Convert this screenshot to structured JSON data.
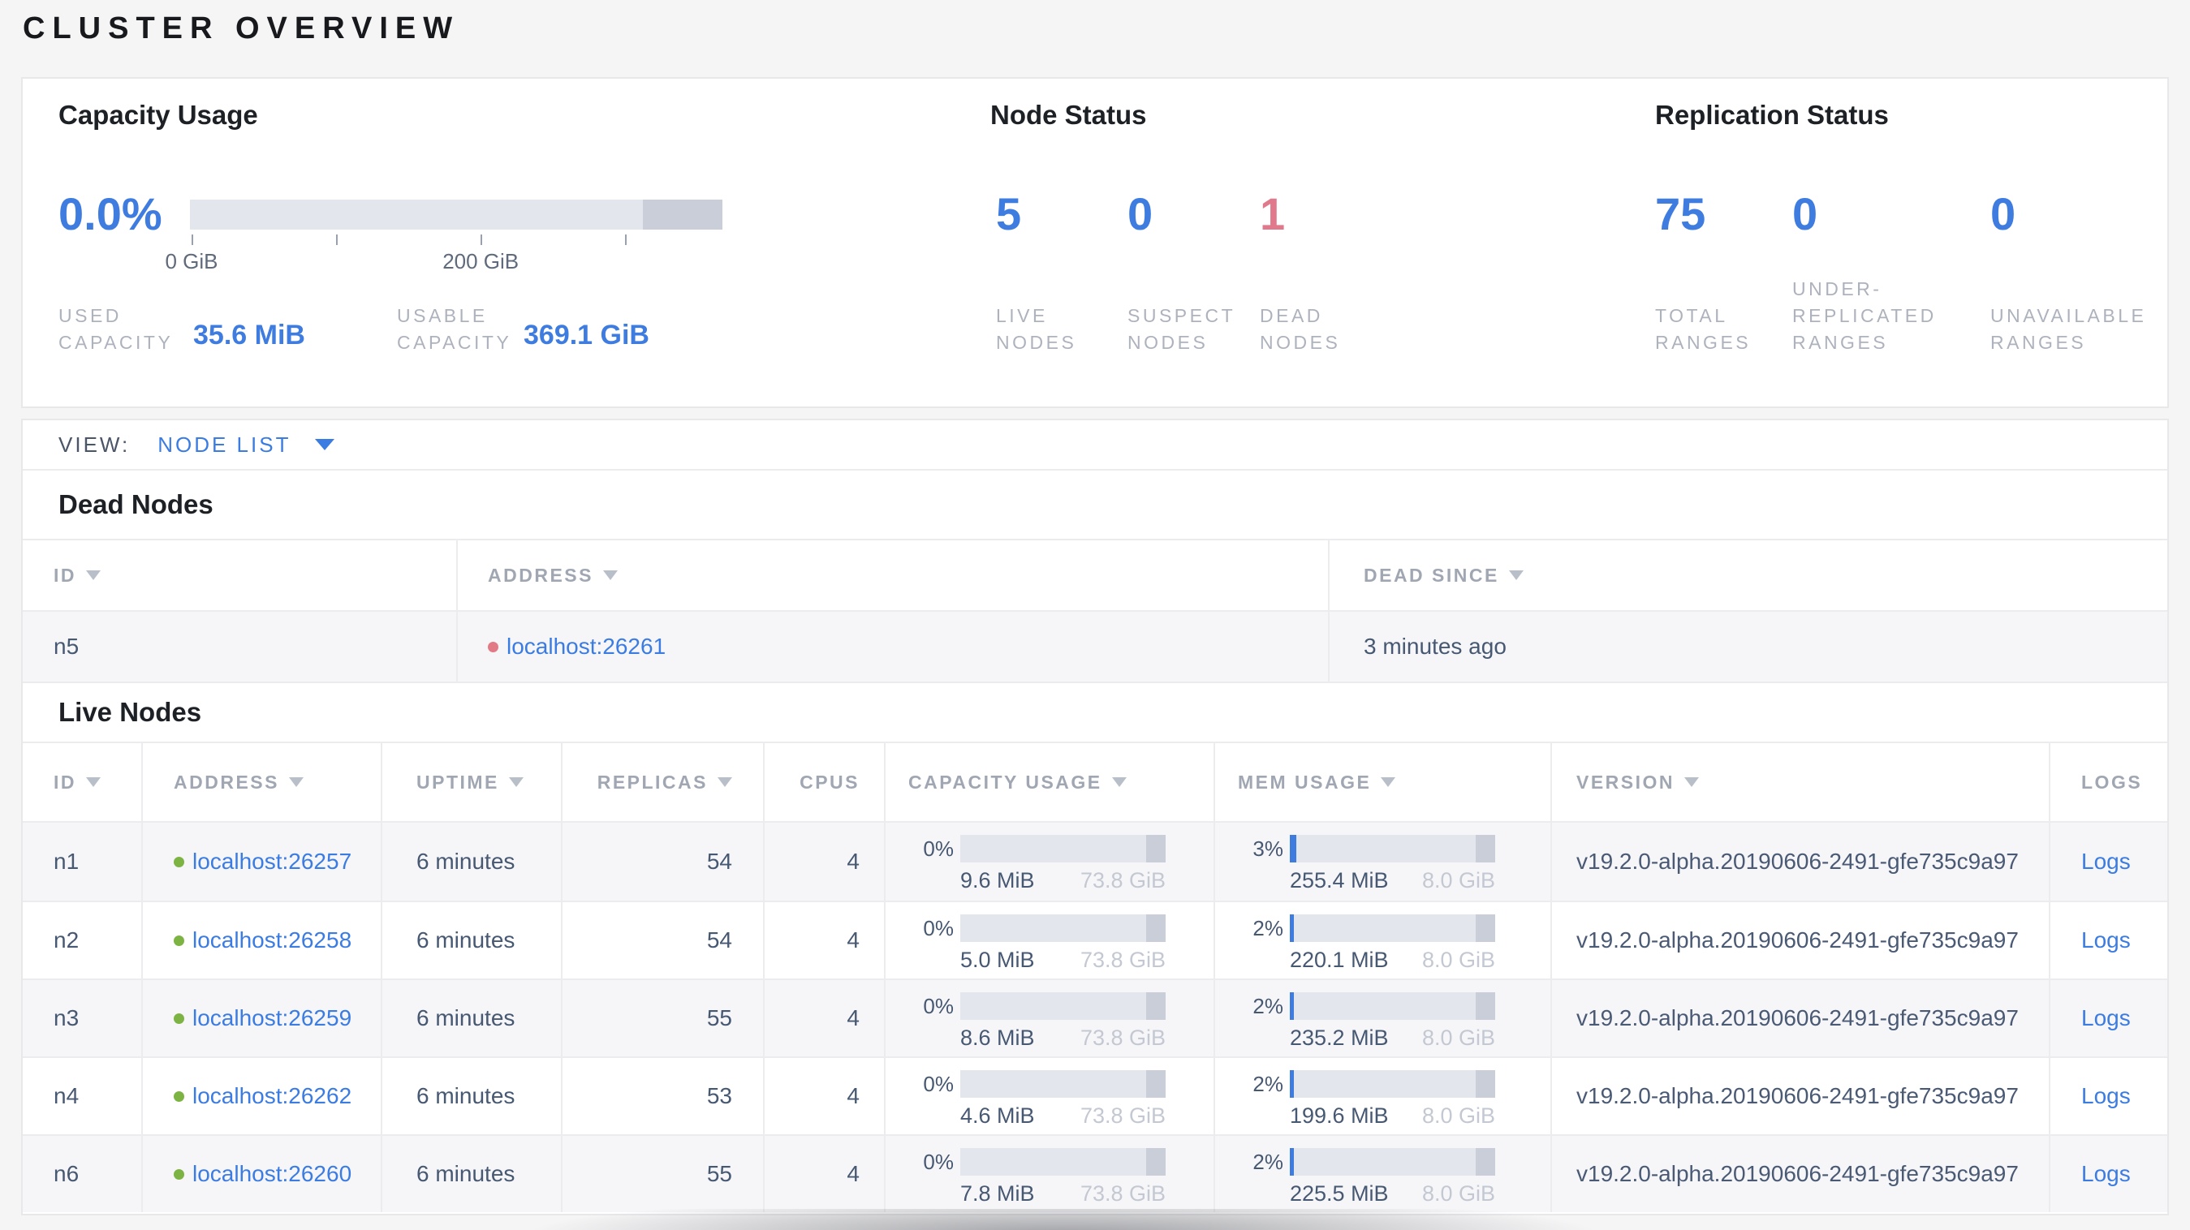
{
  "title": "CLUSTER OVERVIEW",
  "colors": {
    "accent_blue": "#3e7ce0",
    "link_blue": "#3b7ce2",
    "danger_red": "#e0798b",
    "live_green": "#7db343",
    "dead_red": "#e27a86",
    "slate_text": "#475872",
    "muted_label": "#adb2bd"
  },
  "summary": {
    "capacity": {
      "title": "Capacity Usage",
      "percent": "0.0%",
      "used_fraction_pct": 0,
      "unusable_fraction_pct": 15,
      "axis_ticks": [
        {
          "pos": 0.3,
          "label": "0 GiB"
        },
        {
          "pos": 27.4,
          "label": ""
        },
        {
          "pos": 54.6,
          "label": "200 GiB"
        },
        {
          "pos": 81.7,
          "label": ""
        }
      ],
      "used": {
        "label_lines": [
          "USED",
          "CAPACITY"
        ],
        "value": "35.6 MiB"
      },
      "usable": {
        "label_lines": [
          "USABLE",
          "CAPACITY"
        ],
        "value": "369.1 GiB"
      }
    },
    "node_status": {
      "title": "Node Status",
      "stats": [
        {
          "value": "5",
          "label_lines": [
            "LIVE",
            "NODES"
          ],
          "tone": "blue"
        },
        {
          "value": "0",
          "label_lines": [
            "SUSPECT",
            "NODES"
          ],
          "tone": "blue"
        },
        {
          "value": "1",
          "label_lines": [
            "DEAD",
            "NODES"
          ],
          "tone": "red"
        }
      ]
    },
    "replication": {
      "title": "Replication Status",
      "stats": [
        {
          "value": "75",
          "label_lines": [
            "TOTAL",
            "RANGES"
          ],
          "tone": "blue"
        },
        {
          "value": "0",
          "label_lines": [
            "UNDER-",
            "REPLICATED",
            "RANGES"
          ],
          "tone": "blue"
        },
        {
          "value": "0",
          "label_lines": [
            "UNAVAILABLE",
            "RANGES"
          ],
          "tone": "blue"
        }
      ]
    }
  },
  "view_bar": {
    "label": "VIEW:",
    "selected": "NODE LIST"
  },
  "dead_nodes": {
    "heading": "Dead Nodes",
    "columns": [
      {
        "label": "ID",
        "sortable": true
      },
      {
        "label": "ADDRESS",
        "sortable": true
      },
      {
        "label": "DEAD SINCE",
        "sortable": true
      }
    ],
    "rows": [
      {
        "id": "n5",
        "address": "localhost:26261",
        "dead_since": "3 minutes ago"
      }
    ]
  },
  "live_nodes": {
    "heading": "Live Nodes",
    "logs_label": "Logs",
    "columns": [
      {
        "label": "ID",
        "sortable": true
      },
      {
        "label": "ADDRESS",
        "sortable": true
      },
      {
        "label": "UPTIME",
        "sortable": true
      },
      {
        "label": "REPLICAS",
        "sortable": true
      },
      {
        "label": "CPUS",
        "sortable": false
      },
      {
        "label": "CAPACITY USAGE",
        "sortable": true
      },
      {
        "label": "MEM USAGE",
        "sortable": true
      },
      {
        "label": "VERSION",
        "sortable": true
      },
      {
        "label": "LOGS",
        "sortable": false
      }
    ],
    "rows": [
      {
        "id": "n1",
        "address": "localhost:26257",
        "uptime": "6 minutes",
        "replicas": "54",
        "cpus": "4",
        "capacity": {
          "pct": "0%",
          "pct_num": 0,
          "used": "9.6 MiB",
          "total": "73.8 GiB"
        },
        "memory": {
          "pct": "3%",
          "pct_num": 3,
          "used": "255.4 MiB",
          "total": "8.0 GiB"
        },
        "version": "v19.2.0-alpha.20190606-2491-gfe735c9a97"
      },
      {
        "id": "n2",
        "address": "localhost:26258",
        "uptime": "6 minutes",
        "replicas": "54",
        "cpus": "4",
        "capacity": {
          "pct": "0%",
          "pct_num": 0,
          "used": "5.0 MiB",
          "total": "73.8 GiB"
        },
        "memory": {
          "pct": "2%",
          "pct_num": 2,
          "used": "220.1 MiB",
          "total": "8.0 GiB"
        },
        "version": "v19.2.0-alpha.20190606-2491-gfe735c9a97"
      },
      {
        "id": "n3",
        "address": "localhost:26259",
        "uptime": "6 minutes",
        "replicas": "55",
        "cpus": "4",
        "capacity": {
          "pct": "0%",
          "pct_num": 0,
          "used": "8.6 MiB",
          "total": "73.8 GiB"
        },
        "memory": {
          "pct": "2%",
          "pct_num": 2,
          "used": "235.2 MiB",
          "total": "8.0 GiB"
        },
        "version": "v19.2.0-alpha.20190606-2491-gfe735c9a97"
      },
      {
        "id": "n4",
        "address": "localhost:26262",
        "uptime": "6 minutes",
        "replicas": "53",
        "cpus": "4",
        "capacity": {
          "pct": "0%",
          "pct_num": 0,
          "used": "4.6 MiB",
          "total": "73.8 GiB"
        },
        "memory": {
          "pct": "2%",
          "pct_num": 2,
          "used": "199.6 MiB",
          "total": "8.0 GiB"
        },
        "version": "v19.2.0-alpha.20190606-2491-gfe735c9a97"
      },
      {
        "id": "n6",
        "address": "localhost:26260",
        "uptime": "6 minutes",
        "replicas": "55",
        "cpus": "4",
        "capacity": {
          "pct": "0%",
          "pct_num": 0,
          "used": "7.8 MiB",
          "total": "73.8 GiB"
        },
        "memory": {
          "pct": "2%",
          "pct_num": 2,
          "used": "225.5 MiB",
          "total": "8.0 GiB"
        },
        "version": "v19.2.0-alpha.20190606-2491-gfe735c9a97"
      }
    ]
  }
}
